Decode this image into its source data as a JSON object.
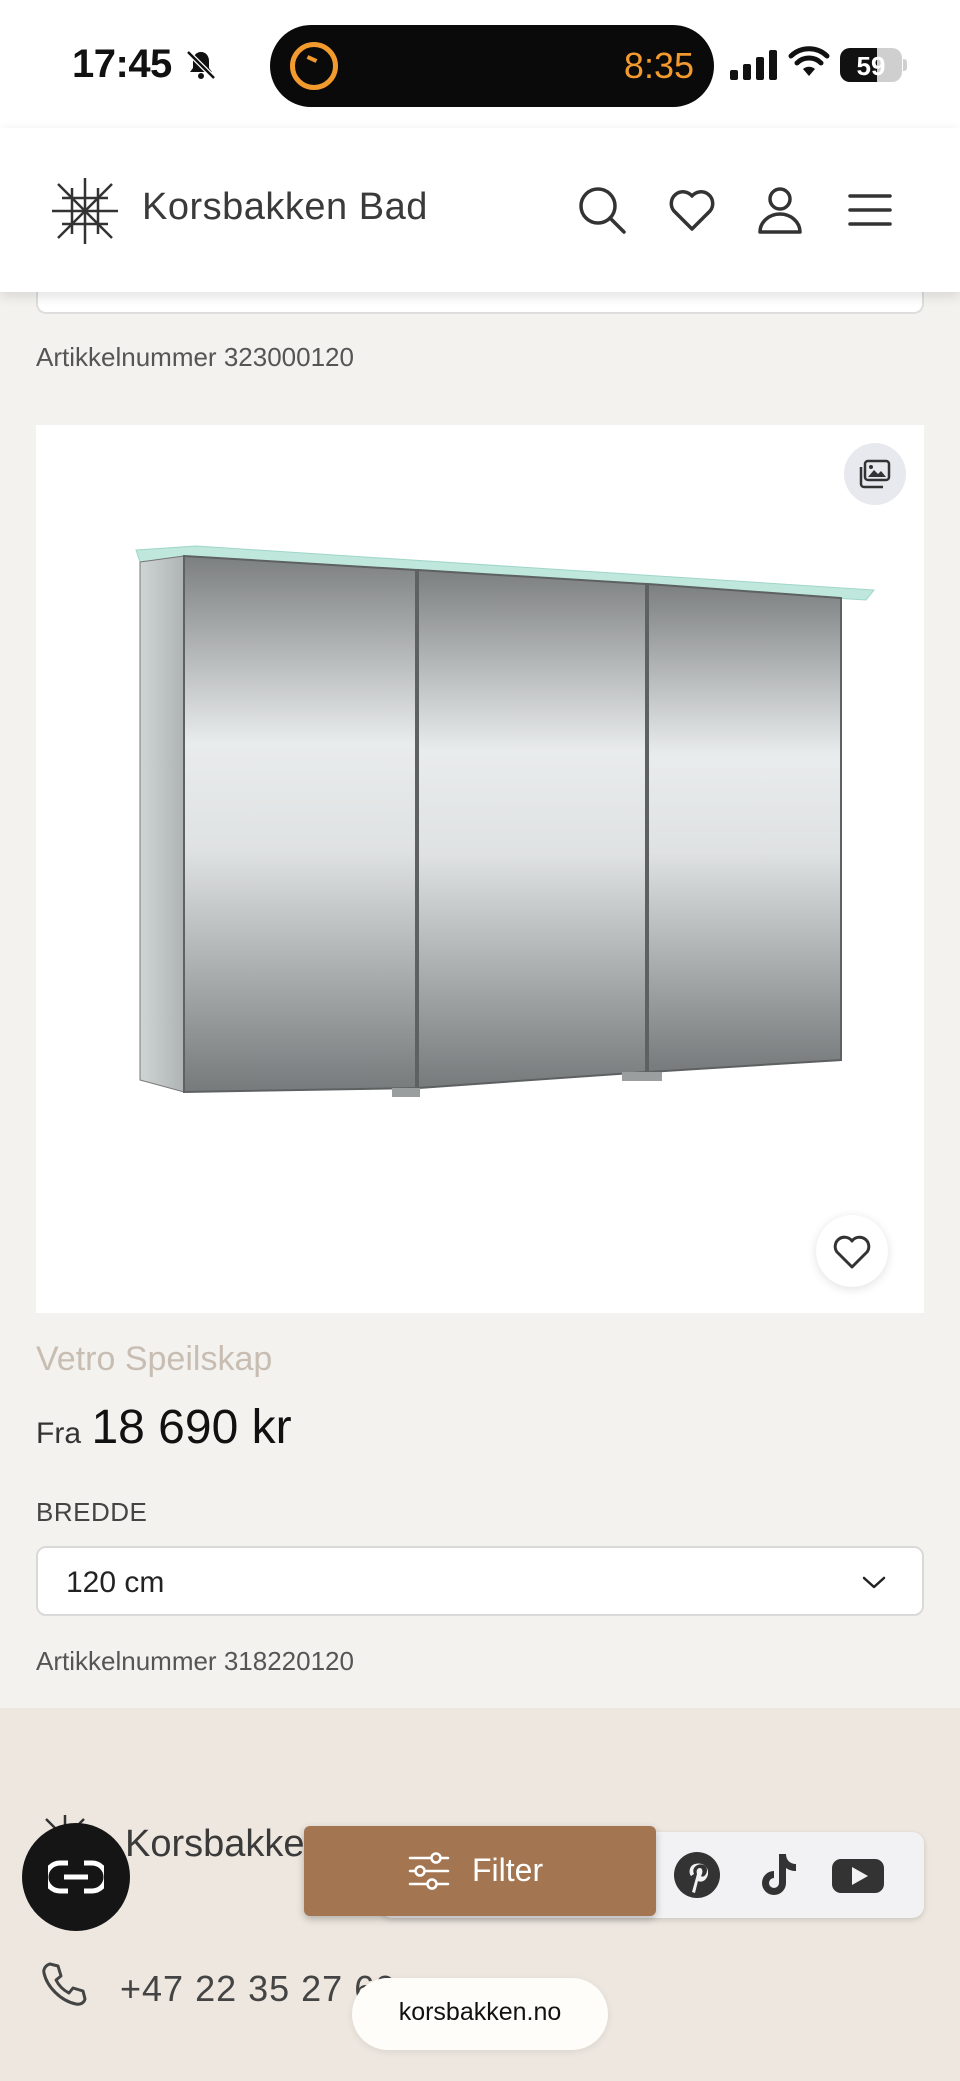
{
  "status_bar": {
    "time": "17:45",
    "timer_countdown": "8:35",
    "battery_level": "59",
    "battery_percent": 59,
    "icons": [
      "silent-bell-icon",
      "timer-icon",
      "cellular-signal-icon",
      "wifi-icon",
      "battery-icon"
    ]
  },
  "header": {
    "brand": "Korsbakken Bad",
    "icons": [
      "search-icon",
      "heart-icon",
      "account-icon",
      "menu-icon"
    ]
  },
  "previous_product": {
    "article_number": "Artikkelnummer 323000120"
  },
  "product": {
    "name": "Vetro Speilskap",
    "price_prefix": "Fra",
    "price": "18 690 kr",
    "width_label": "BREDDE",
    "width_selected": "120 cm",
    "article_number": "Artikkelnummer 318220120",
    "icons": [
      "gallery-icon",
      "favorite-heart-icon",
      "chevron-down-icon"
    ]
  },
  "footer": {
    "brand": "Korsbakken",
    "phone": "+47 22 35 27 60",
    "social_icons": [
      "pinterest-icon",
      "tiktok-icon",
      "youtube-icon"
    ]
  },
  "floating": {
    "filter_label": "Filter",
    "url": "korsbakken.no"
  },
  "colors": {
    "accent": "#a47551",
    "page_background": "#f4f2ee",
    "footer_background": "#ede7df",
    "product_name": "#c7bdb2",
    "timer": "#f39a2f"
  }
}
